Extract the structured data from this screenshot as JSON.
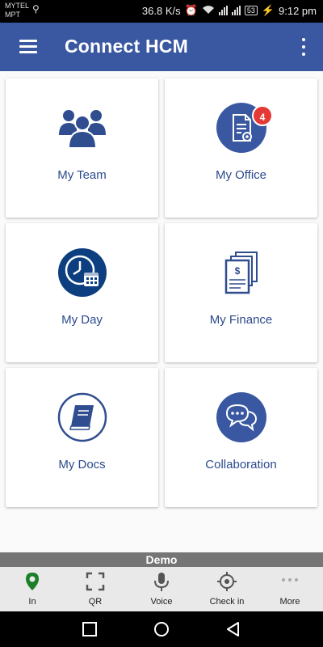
{
  "status_bar": {
    "carrier_line1": "MYTEL",
    "carrier_line2": "MPT",
    "speed": "36.8 K/s",
    "battery": "53",
    "time": "9:12 pm"
  },
  "app_bar": {
    "title": "Connect HCM"
  },
  "tiles": [
    {
      "label": "My Team",
      "icon": "team-icon"
    },
    {
      "label": "My Office",
      "icon": "office-document-icon",
      "badge": "4"
    },
    {
      "label": "My Day",
      "icon": "clock-calendar-icon"
    },
    {
      "label": "My Finance",
      "icon": "finance-documents-icon"
    },
    {
      "label": "My Docs",
      "icon": "book-icon"
    },
    {
      "label": "Collaboration",
      "icon": "chat-bubbles-icon"
    }
  ],
  "demo_banner": "Demo",
  "bottom_nav": [
    {
      "label": "In",
      "icon": "location-pin-icon"
    },
    {
      "label": "QR",
      "icon": "qr-scan-icon"
    },
    {
      "label": "Voice",
      "icon": "microphone-icon"
    },
    {
      "label": "Check in",
      "icon": "crosshair-icon"
    },
    {
      "label": "More",
      "icon": "more-dots-icon"
    }
  ],
  "colors": {
    "primary": "#3a58a1",
    "icon_blue": "#2f4d8f",
    "badge_red": "#e53935",
    "pin_green": "#1b7f2a"
  }
}
